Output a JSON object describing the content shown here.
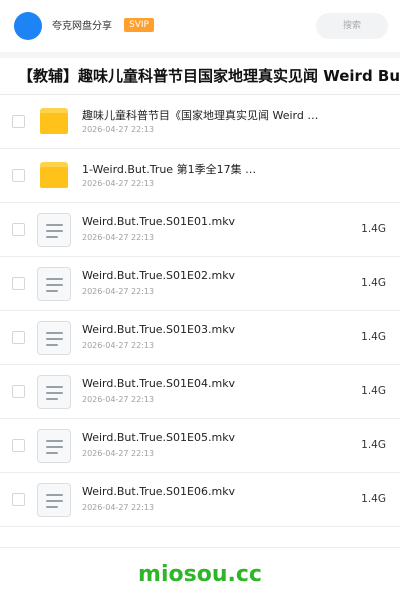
{
  "header": {
    "app_title": "夸克网盘分享",
    "badge": "SVIP",
    "search_placeholder": "搜索"
  },
  "page_title": "【教辅】趣味儿童科普节目国家地理真实见闻 Weird But ·",
  "files": [
    {
      "type": "folder",
      "name": "趣味儿童科普节目《国家地理真实见闻  Weird …",
      "date": "2026-04-27 22:13",
      "size": ""
    },
    {
      "type": "folder",
      "name": "1-Weird.But.True 第1季全17集 …",
      "date": "2026-04-27 22:13",
      "size": ""
    },
    {
      "type": "file",
      "name": "Weird.But.True.S01E01.mkv",
      "date": "2026-04-27 22:13",
      "size": "1.4G"
    },
    {
      "type": "file",
      "name": "Weird.But.True.S01E02.mkv",
      "date": "2026-04-27 22:13",
      "size": "1.4G"
    },
    {
      "type": "file",
      "name": "Weird.But.True.S01E03.mkv",
      "date": "2026-04-27 22:13",
      "size": "1.4G"
    },
    {
      "type": "file",
      "name": "Weird.But.True.S01E04.mkv",
      "date": "2026-04-27 22:13",
      "size": "1.4G"
    },
    {
      "type": "file",
      "name": "Weird.But.True.S01E05.mkv",
      "date": "2026-04-27 22:13",
      "size": "1.4G"
    },
    {
      "type": "file",
      "name": "Weird.But.True.S01E06.mkv",
      "date": "2026-04-27 22:13",
      "size": "1.4G"
    }
  ],
  "watermark": "miosou.cc",
  "colors": {
    "avatar": "#1e83f5",
    "svip_badge": "#ff9f2e",
    "folder": "#ffc21a",
    "watermark": "#2eb52a"
  }
}
